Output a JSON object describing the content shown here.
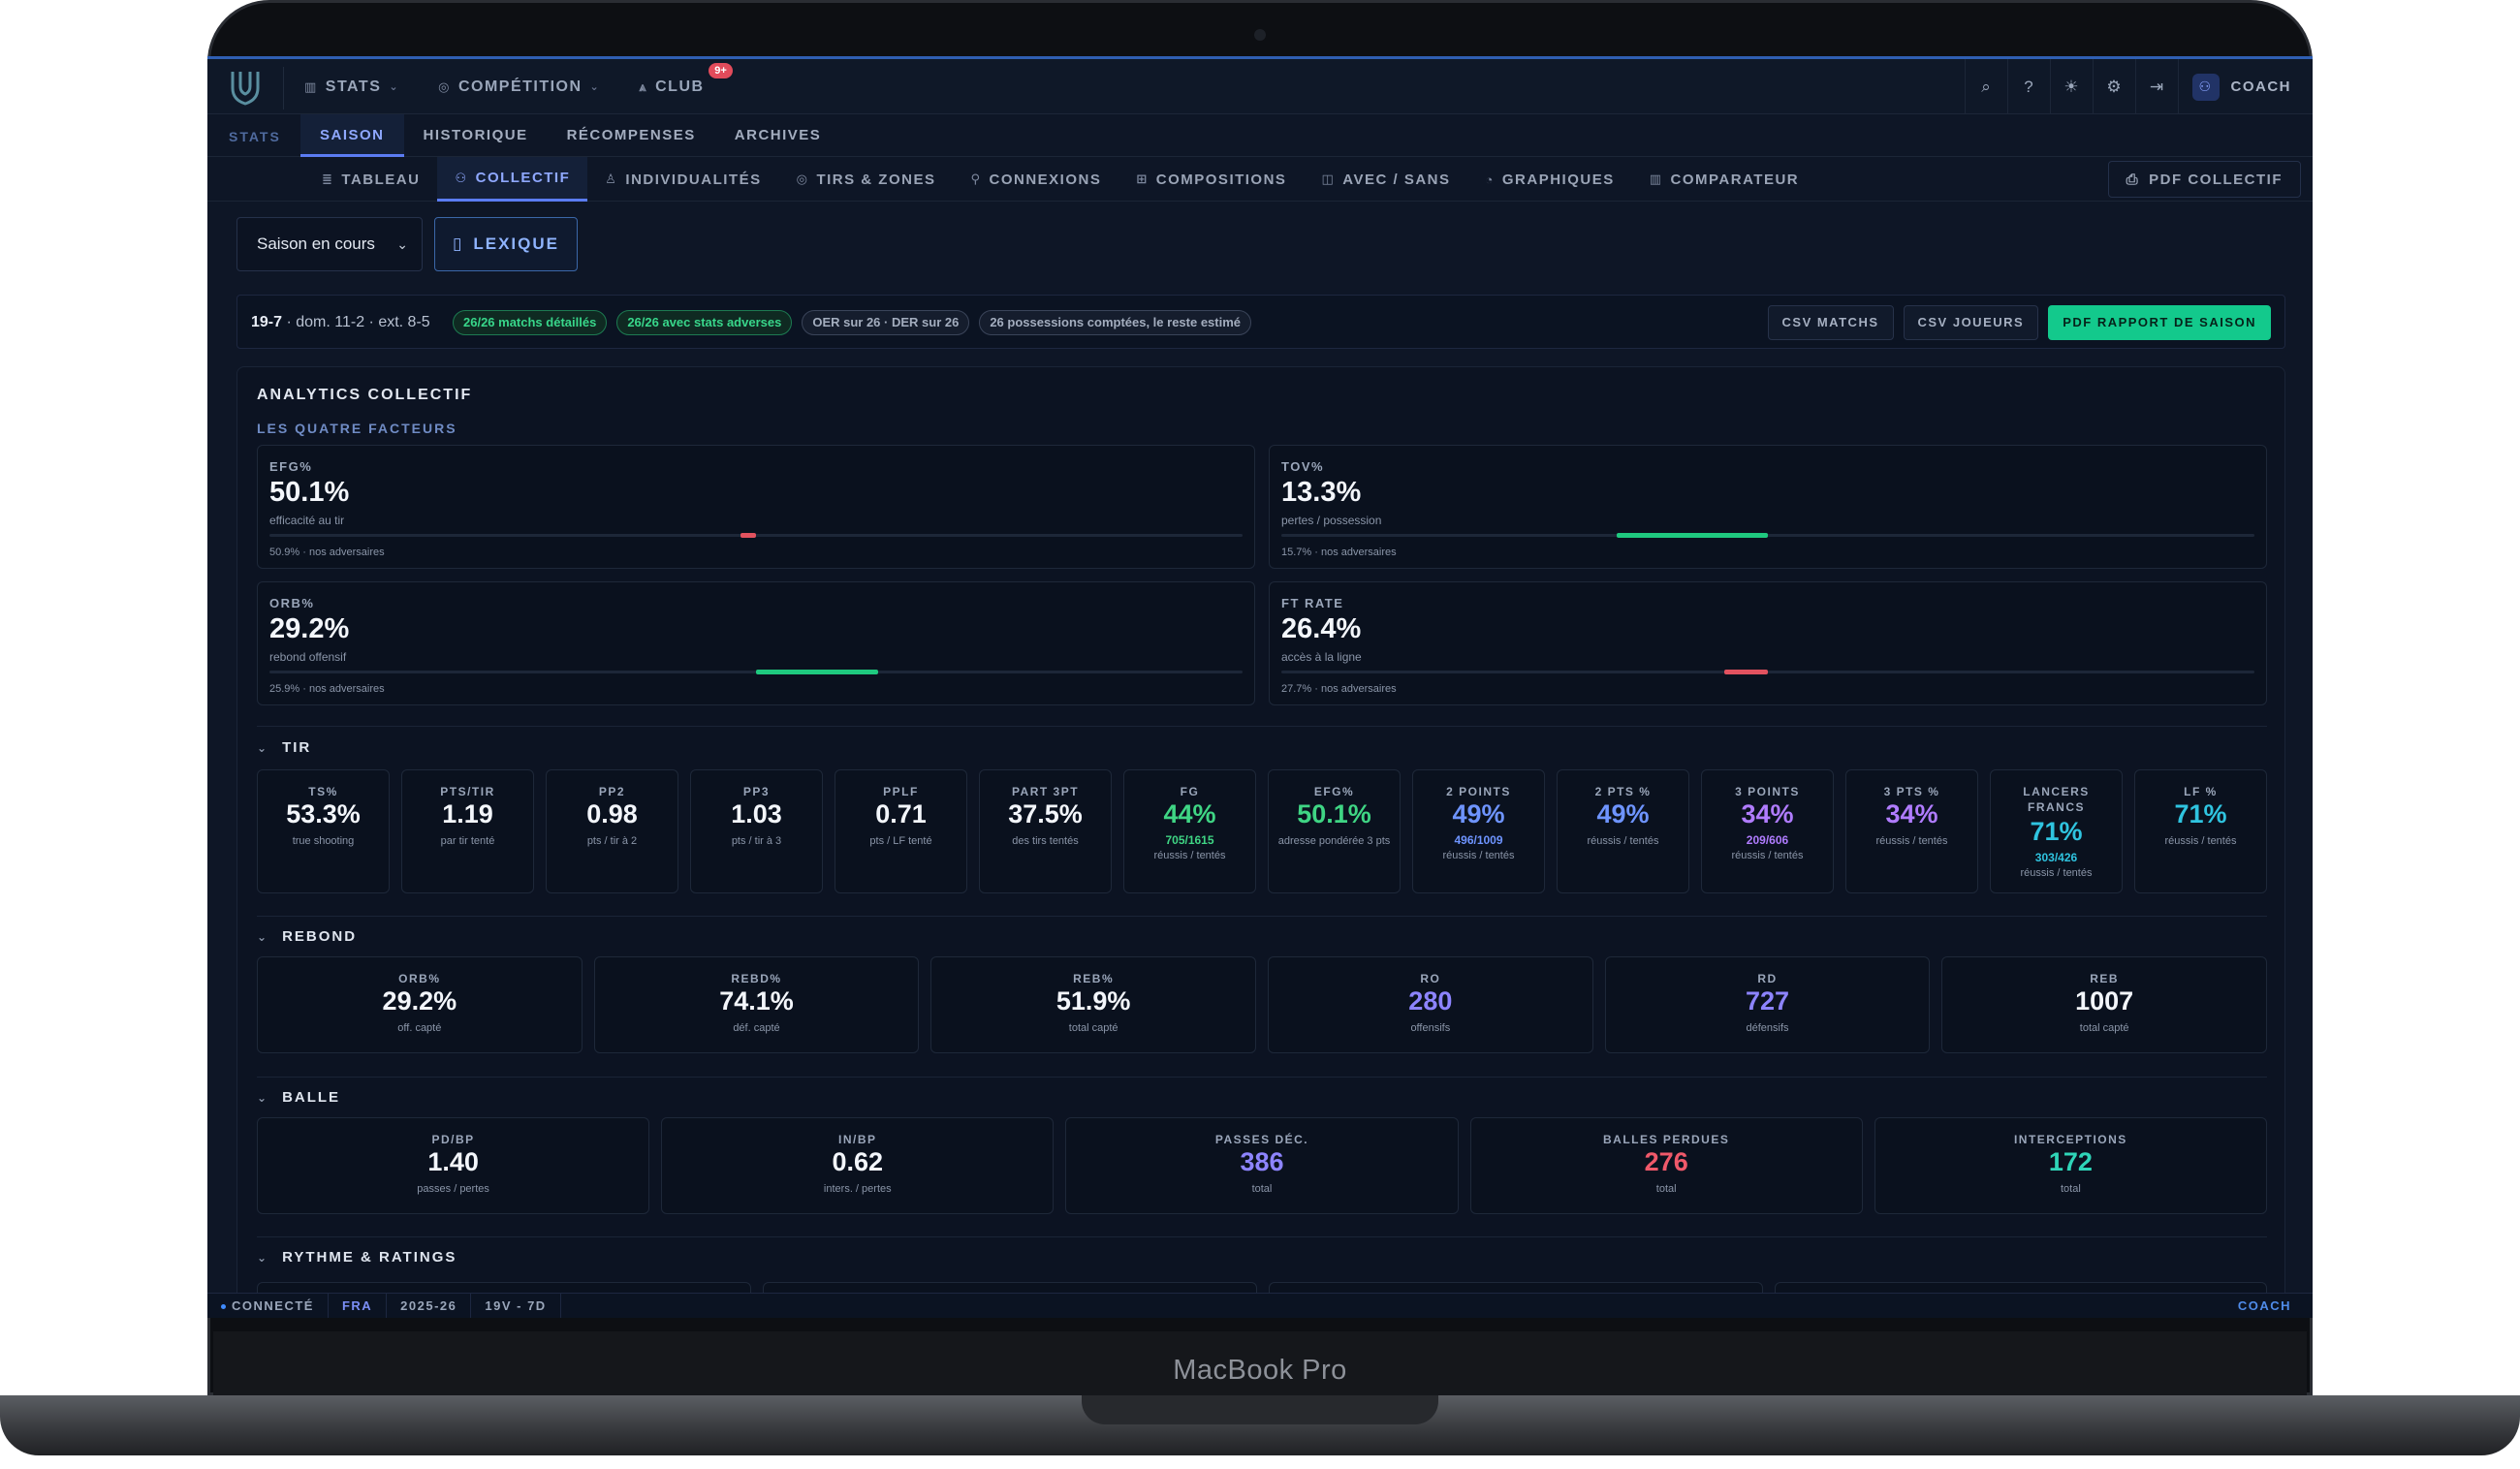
{
  "device": {
    "brand": "MacBook Pro"
  },
  "topbar": {
    "nav": [
      {
        "label": "STATS",
        "icon": "bar-chart-icon",
        "has_dropdown": true
      },
      {
        "label": "COMPÉTITION",
        "icon": "trophy-icon",
        "has_dropdown": true
      },
      {
        "label": "CLUB",
        "icon": "club-icon",
        "badge": "9+"
      }
    ],
    "icons": [
      "search-icon",
      "help-icon",
      "theme-icon",
      "settings-icon",
      "logout-icon"
    ],
    "user_label": "COACH"
  },
  "subnav": {
    "section_label": "STATS",
    "tabs": [
      "SAISON",
      "HISTORIQUE",
      "RÉCOMPENSES",
      "ARCHIVES"
    ],
    "active": "SAISON"
  },
  "tabs": {
    "items": [
      "TABLEAU",
      "COLLECTIF",
      "INDIVIDUALITÉS",
      "TIRS & ZONES",
      "CONNEXIONS",
      "COMPOSITIONS",
      "AVEC / SANS",
      "GRAPHIQUES",
      "COMPARATEUR"
    ],
    "active": "COLLECTIF",
    "pdf_label": "PDF COLLECTIF"
  },
  "controls": {
    "season_select": "Saison en cours",
    "lexique": "LEXIQUE"
  },
  "summary": {
    "record": "19-7",
    "record_detail": " · dom. 11-2 · ext. 8-5",
    "pills": [
      {
        "text": "26/26 matchs détaillés",
        "tone": "green"
      },
      {
        "text": "26/26 avec stats adverses",
        "tone": "green"
      },
      {
        "text": "OER sur 26 · DER sur 26",
        "tone": "gray"
      },
      {
        "text": "26 possessions comptées, le reste estimé",
        "tone": "gray"
      }
    ],
    "buttons": {
      "csv_matchs": "CSV MATCHS",
      "csv_joueurs": "CSV JOUEURS",
      "pdf_rapport": "PDF RAPPORT DE SAISON"
    }
  },
  "analytics": {
    "title": "ANALYTICS COLLECTIF",
    "four_factors_title": "LES QUATRE FACTEURS",
    "four_factors": [
      {
        "label": "EFG%",
        "value": "50.1%",
        "desc": "efficacité au tir",
        "opp": "50.9% · nos adversaires",
        "bar_from": 0.5,
        "bar_to": 0.484,
        "bar_color": "#e2525f"
      },
      {
        "label": "TOV%",
        "value": "13.3%",
        "desc": "pertes / possession",
        "opp": "15.7% · nos adversaires",
        "bar_from": 0.5,
        "bar_to": 0.345,
        "bar_color": "#1fc97f"
      },
      {
        "label": "ORB%",
        "value": "29.2%",
        "desc": "rebond offensif",
        "opp": "25.9% · nos adversaires",
        "bar_from": 0.5,
        "bar_to": 0.625,
        "bar_color": "#1fc97f"
      },
      {
        "label": "FT RATE",
        "value": "26.4%",
        "desc": "accès à la ligne",
        "opp": "27.7% · nos adversaires",
        "bar_from": 0.5,
        "bar_to": 0.455,
        "bar_color": "#e2525f"
      }
    ],
    "tir_title": "TIR",
    "tir": [
      {
        "label": "TS%",
        "value": "53.3%",
        "desc": "true shooting",
        "color": "#f3f6fb"
      },
      {
        "label": "PTS/TIR",
        "value": "1.19",
        "desc": "par tir tenté",
        "color": "#f3f6fb"
      },
      {
        "label": "PP2",
        "value": "0.98",
        "desc": "pts / tir à 2",
        "color": "#f3f6fb"
      },
      {
        "label": "PP3",
        "value": "1.03",
        "desc": "pts / tir à 3",
        "color": "#f3f6fb"
      },
      {
        "label": "PPLF",
        "value": "0.71",
        "desc": "pts / LF tenté",
        "color": "#f3f6fb"
      },
      {
        "label": "PART 3PT",
        "value": "37.5%",
        "desc": "des tirs tentés",
        "color": "#f3f6fb"
      },
      {
        "label": "FG",
        "value": "44%",
        "made": "705/1615",
        "desc": "réussis / tentés",
        "color": "#3fd584",
        "made_color": "#3fd584"
      },
      {
        "label": "EFG%",
        "value": "50.1%",
        "desc": "adresse pondérée 3 pts",
        "color": "#3fd584"
      },
      {
        "label": "2 POINTS",
        "value": "49%",
        "made": "496/1009",
        "desc": "réussis / tentés",
        "color": "#6e94ff",
        "made_color": "#6e94ff"
      },
      {
        "label": "2 PTS %",
        "value": "49%",
        "desc": "réussis / tentés",
        "color": "#6e94ff"
      },
      {
        "label": "3 POINTS",
        "value": "34%",
        "made": "209/606",
        "desc": "réussis / tentés",
        "color": "#b07cff",
        "made_color": "#b07cff"
      },
      {
        "label": "3 PTS %",
        "value": "34%",
        "desc": "réussis / tentés",
        "color": "#b07cff"
      },
      {
        "label": "LANCERS FRANCS",
        "value": "71%",
        "made": "303/426",
        "desc": "réussis / tentés",
        "color": "#2fc4e0",
        "made_color": "#2fc4e0"
      },
      {
        "label": "LF %",
        "value": "71%",
        "desc": "réussis / tentés",
        "color": "#2fc4e0"
      }
    ],
    "rebond_title": "REBOND",
    "rebond": [
      {
        "label": "ORB%",
        "value": "29.2%",
        "desc": "off. capté",
        "color": "#f3f6fb"
      },
      {
        "label": "REBD%",
        "value": "74.1%",
        "desc": "déf. capté",
        "color": "#f3f6fb"
      },
      {
        "label": "REB%",
        "value": "51.9%",
        "desc": "total capté",
        "color": "#f3f6fb"
      },
      {
        "label": "RO",
        "value": "280",
        "desc": "offensifs",
        "color": "#8d84ff"
      },
      {
        "label": "RD",
        "value": "727",
        "desc": "défensifs",
        "color": "#8d84ff"
      },
      {
        "label": "REB",
        "value": "1007",
        "desc": "total capté",
        "color": "#f3f6fb"
      }
    ],
    "balle_title": "BALLE",
    "balle": [
      {
        "label": "PD/BP",
        "value": "1.40",
        "desc": "passes / pertes",
        "color": "#f3f6fb"
      },
      {
        "label": "IN/BP",
        "value": "0.62",
        "desc": "inters. / pertes",
        "color": "#f3f6fb"
      },
      {
        "label": "PASSES DÉC.",
        "value": "386",
        "desc": "total",
        "color": "#8d84ff"
      },
      {
        "label": "BALLES PERDUES",
        "value": "276",
        "desc": "total",
        "color": "#f0596a"
      },
      {
        "label": "INTERCEPTIONS",
        "value": "172",
        "desc": "total",
        "color": "#2fd5b8"
      }
    ],
    "rythme_title": "RYTHME & RATINGS"
  },
  "statusbar": {
    "connected": "CONNECTÉ",
    "lang": "FRA",
    "season": "2025-26",
    "record": "19V - 7D",
    "role": "COACH"
  }
}
